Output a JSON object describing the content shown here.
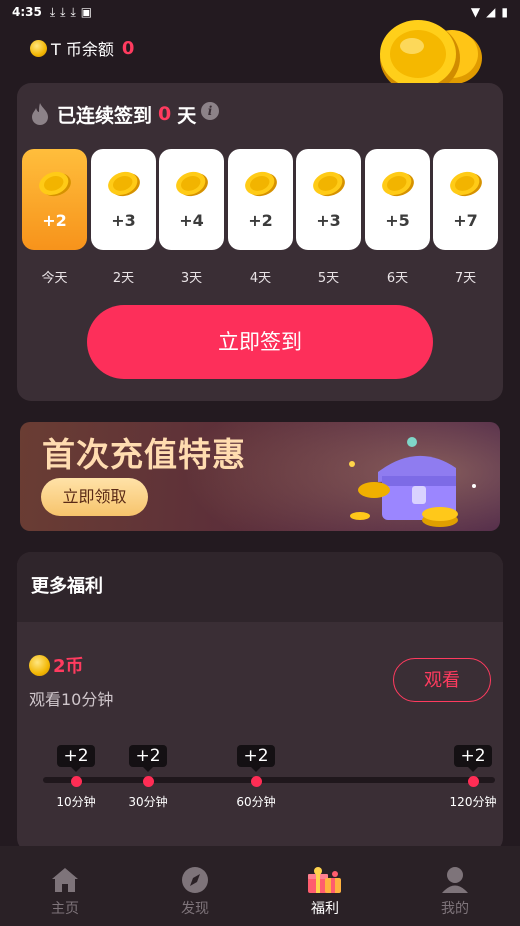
{
  "status_bar": {
    "time": "4:35"
  },
  "balance": {
    "label": "T 币余额",
    "value": "0"
  },
  "checkin": {
    "title_prefix": "已连续签到",
    "streak": "0",
    "title_suffix": "天",
    "info_glyph": "i",
    "days": [
      {
        "amount": "+2",
        "label": "今天",
        "active": true
      },
      {
        "amount": "+3",
        "label": "2天"
      },
      {
        "amount": "+4",
        "label": "3天"
      },
      {
        "amount": "+2",
        "label": "4天"
      },
      {
        "amount": "+3",
        "label": "5天"
      },
      {
        "amount": "+5",
        "label": "6天"
      },
      {
        "amount": "+7",
        "label": "7天"
      }
    ],
    "sign_button": "立即签到"
  },
  "banner": {
    "title": "首次充值特惠",
    "button": "立即领取"
  },
  "more_welfare": {
    "title": "更多福利",
    "reward_amount": "2币",
    "reward_desc": "观看10分钟",
    "watch_button": "观看",
    "milestones": [
      {
        "bonus": "+2",
        "label": "10分钟"
      },
      {
        "bonus": "+2",
        "label": "30分钟"
      },
      {
        "bonus": "+2",
        "label": "60分钟"
      },
      {
        "bonus": "+2",
        "label": "120分钟"
      }
    ]
  },
  "tabbar": {
    "tabs": [
      {
        "label": "主页",
        "icon": "home-icon"
      },
      {
        "label": "发现",
        "icon": "compass-icon"
      },
      {
        "label": "福利",
        "icon": "gift-icon",
        "active": true
      },
      {
        "label": "我的",
        "icon": "profile-icon"
      }
    ]
  },
  "colors": {
    "accent": "#fd2f5a",
    "background": "#231a20",
    "card": "#3a2e35",
    "coin": "#f2b705"
  }
}
